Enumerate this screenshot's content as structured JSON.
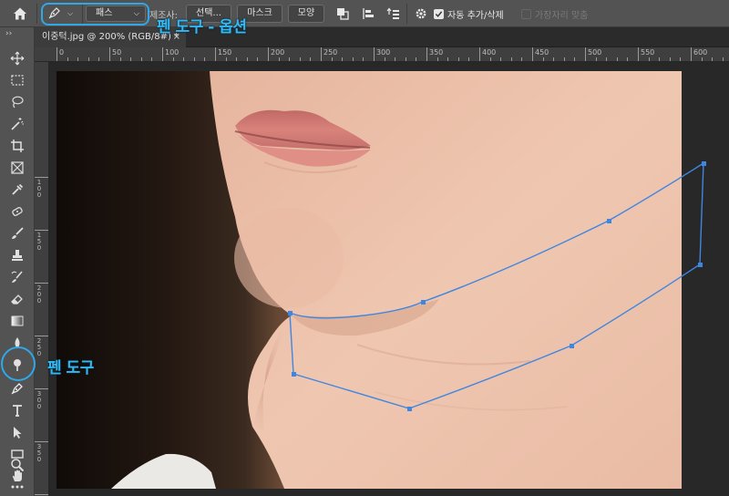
{
  "options_bar": {
    "mode": "패스",
    "make_label": "제조사:",
    "select_button": "선택...",
    "mask_button": "마스크",
    "shape_button": "모양",
    "auto_add_delete": "자동 추가/삭제",
    "auto_add_delete_checked": true,
    "align_edges": "가장자리 맞춤",
    "align_edges_checked": false
  },
  "document_tab": {
    "title": "이중턱.jpg @ 200% (RGB/8#) *",
    "close": "×"
  },
  "rulers": {
    "horizontal": [
      "0",
      "50",
      "100",
      "150",
      "200",
      "250",
      "300",
      "350",
      "400",
      "450",
      "500",
      "550",
      "600"
    ],
    "vertical": [
      "100",
      "150",
      "200",
      "250",
      "300",
      "350",
      "4"
    ]
  },
  "annotations": {
    "options_callout": "펜 도구 - 옵션",
    "tool_callout": "펜 도구"
  },
  "colors": {
    "highlight": "#2ea8e6",
    "path": "#3f86e0",
    "ui_panel": "#535353"
  },
  "icons": [
    "home-icon",
    "pen-tool-icon",
    "path-operations-icon",
    "path-alignment-icon",
    "path-arrangement-icon",
    "gear-icon"
  ]
}
